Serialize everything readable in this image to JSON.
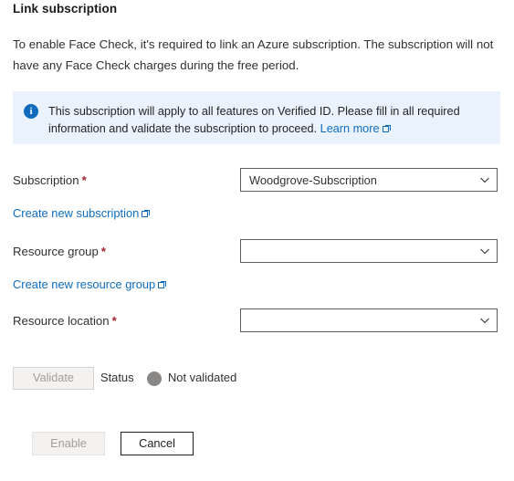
{
  "page": {
    "title": "Link subscription",
    "intro": "To enable Face Check, it's required to link an Azure subscription. The subscription will not have any Face Check charges during the free period."
  },
  "info_banner": {
    "icon": "info-circle-icon",
    "text": "This subscription will apply to all features on Verified ID. Please fill in all required information and validate the subscription to proceed.",
    "link_label": "Learn more",
    "link_icon": "external-link-icon",
    "background_color": "#eaf2fd",
    "icon_color": "#0f6cbd"
  },
  "form": {
    "required_marker": "*",
    "subscription": {
      "label": "Subscription",
      "required": true,
      "value": "Woodgrove-Subscription",
      "placeholder": "",
      "chevron_icon": "chevron-down-icon"
    },
    "create_subscription_link": {
      "label": "Create new subscription",
      "icon": "external-link-icon"
    },
    "resource_group": {
      "label": "Resource group",
      "required": true,
      "value": "",
      "placeholder": "",
      "chevron_icon": "chevron-down-icon"
    },
    "create_resource_group_link": {
      "label": "Create new resource group",
      "icon": "external-link-icon"
    },
    "resource_location": {
      "label": "Resource location",
      "required": true,
      "value": "",
      "placeholder": "",
      "chevron_icon": "chevron-down-icon"
    }
  },
  "validation": {
    "validate_button": "Validate",
    "status_label": "Status",
    "status_value": "Not validated",
    "status_dot_color": "#8a8886"
  },
  "footer": {
    "enable_button": "Enable",
    "cancel_button": "Cancel"
  },
  "colors": {
    "link": "#0f6cbd",
    "required_asterisk": "#a4262c",
    "text": "#323130",
    "disabled_text": "#a19f9d"
  }
}
